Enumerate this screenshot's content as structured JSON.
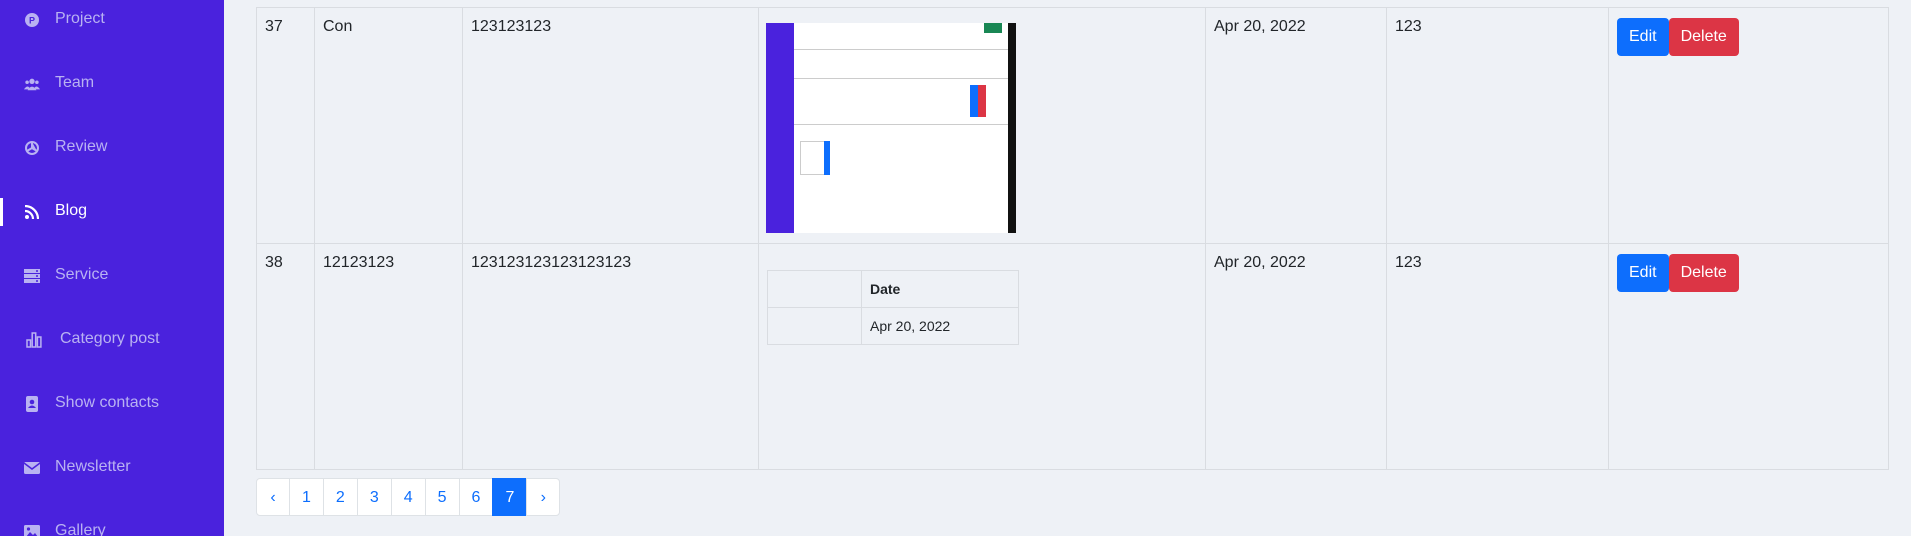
{
  "sidebar": {
    "items": [
      {
        "label": "Project",
        "icon": "project-icon",
        "active": false
      },
      {
        "label": "Team",
        "icon": "team-icon",
        "active": false
      },
      {
        "label": "Review",
        "icon": "review-icon",
        "active": false
      },
      {
        "label": "Blog",
        "icon": "rss-icon",
        "active": true
      },
      {
        "label": "Service",
        "icon": "service-icon",
        "active": false
      },
      {
        "label": "Category post",
        "icon": "chart-bar-icon",
        "active": false
      },
      {
        "label": "Show contacts",
        "icon": "contacts-icon",
        "active": false
      },
      {
        "label": "Newsletter",
        "icon": "envelope-icon",
        "active": false
      },
      {
        "label": "Gallery",
        "icon": "image-icon",
        "active": false
      }
    ]
  },
  "table": {
    "rows": [
      {
        "id": "37",
        "title": "Con",
        "content": "123123123",
        "date": "Apr 20, 2022",
        "category": "123",
        "edit_label": "Edit",
        "delete_label": "Delete"
      },
      {
        "id": "38",
        "title": "12123123",
        "content": "123123123123123123",
        "date": "Apr 20, 2022",
        "category": "123",
        "edit_label": "Edit",
        "delete_label": "Delete",
        "image_mini_table": {
          "header": "Date",
          "value": "Apr 20, 2022"
        }
      }
    ]
  },
  "pagination": {
    "prev": "‹",
    "pages": [
      "1",
      "2",
      "3",
      "4",
      "5",
      "6",
      "7"
    ],
    "current": "7",
    "next": "›"
  },
  "colors": {
    "sidebar_bg": "#4a22dd",
    "primary": "#0d6efd",
    "danger": "#dc3545",
    "page_bg": "#eef1f6"
  }
}
